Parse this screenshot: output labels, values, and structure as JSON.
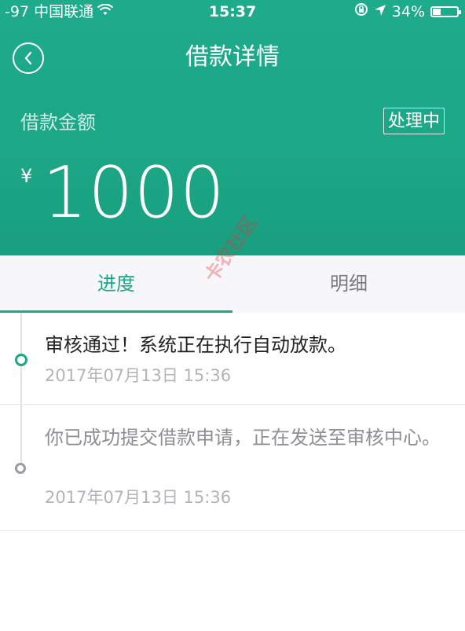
{
  "status_bar": {
    "carrier": "-97 中国联通",
    "time": "15:37",
    "battery": "34%",
    "battery_level": 0.34
  },
  "nav": {
    "title": "借款详情"
  },
  "loan": {
    "amount_label": "借款金额",
    "status": "处理中",
    "currency_symbol": "¥",
    "amount": "1000"
  },
  "tabs": [
    {
      "label": "进度",
      "active": true
    },
    {
      "label": "明细",
      "active": false
    }
  ],
  "timeline": [
    {
      "text": "审核通过！系统正在执行自动放款。",
      "time": "2017年07月13日 15:36",
      "current": true
    },
    {
      "text": "你已成功提交借款申请，正在发送至审核中心。",
      "time": "2017年07月13日 15:36",
      "current": false
    }
  ],
  "watermark": "卡农社区",
  "colors": {
    "accent": "#1ca786",
    "watermark": "#e8323c"
  }
}
